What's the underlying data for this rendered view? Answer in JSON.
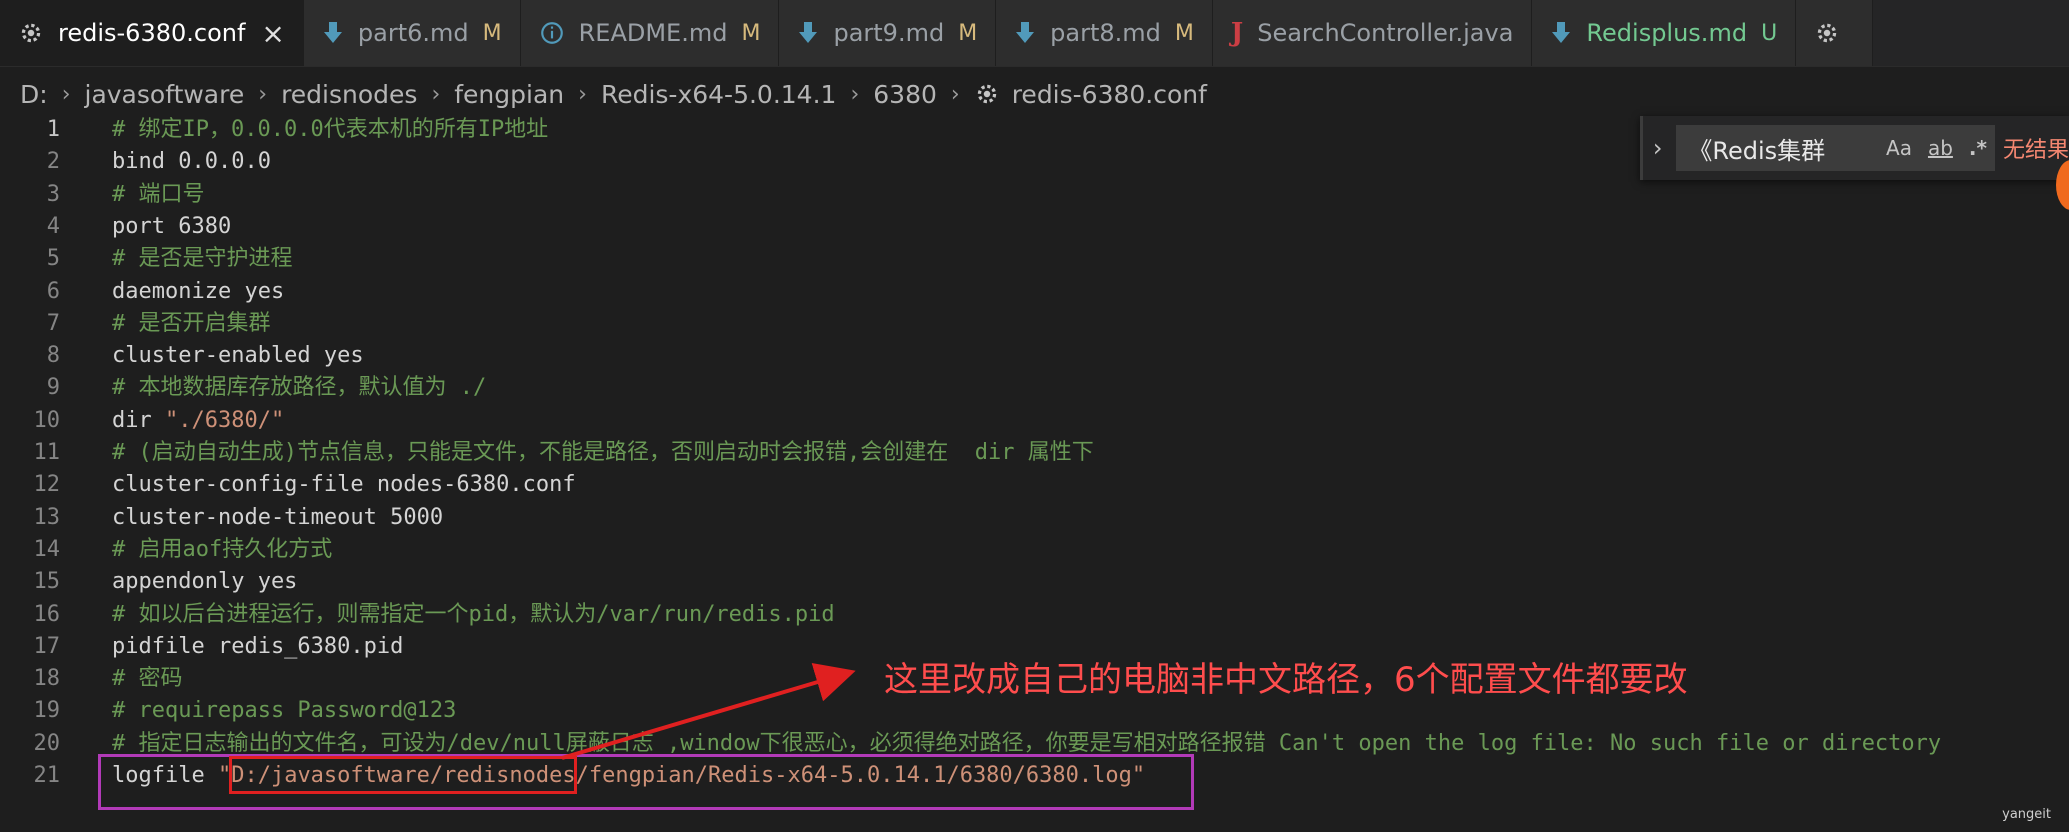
{
  "tabs": [
    {
      "label": "redis-6380.conf",
      "icon": "gear-icon",
      "badge": "",
      "active": true,
      "close": "×"
    },
    {
      "label": "part6.md",
      "icon": "markdown-download-icon",
      "badge": "M",
      "badge_color": "#d7ba7d"
    },
    {
      "label": "README.md",
      "icon": "info-icon",
      "badge": "M",
      "badge_color": "#d7ba7d"
    },
    {
      "label": "part9.md",
      "icon": "markdown-download-icon",
      "badge": "M",
      "badge_color": "#d7ba7d"
    },
    {
      "label": "part8.md",
      "icon": "markdown-download-icon",
      "badge": "M",
      "badge_color": "#d7ba7d"
    },
    {
      "label": "SearchController.java",
      "icon": "java-icon",
      "badge": ""
    },
    {
      "label": "Redisplus.md",
      "icon": "markdown-download-icon",
      "badge": "U",
      "badge_color": "#73c991",
      "label_color": "#73c991"
    }
  ],
  "breadcrumb": [
    "D:",
    "javasoftware",
    "redisnodes",
    "fengpian",
    "Redis-x64-5.0.14.1",
    "6380",
    "redis-6380.conf"
  ],
  "editor": {
    "current_line": 1,
    "lines": [
      {
        "n": "1",
        "type": "comment",
        "text": "# 绑定IP，0.0.0.0代表本机的所有IP地址"
      },
      {
        "n": "2",
        "type": "code",
        "text": "bind 0.0.0.0"
      },
      {
        "n": "3",
        "type": "comment",
        "text": "# 端口号"
      },
      {
        "n": "4",
        "type": "code",
        "text": "port 6380"
      },
      {
        "n": "5",
        "type": "comment",
        "text": "# 是否是守护进程"
      },
      {
        "n": "6",
        "type": "code",
        "text": "daemonize yes"
      },
      {
        "n": "7",
        "type": "comment",
        "text": "# 是否开启集群"
      },
      {
        "n": "8",
        "type": "code",
        "text": "cluster-enabled yes"
      },
      {
        "n": "9",
        "type": "comment",
        "text": "# 本地数据库存放路径，默认值为 ./"
      },
      {
        "n": "10",
        "type": "string",
        "text": "dir ",
        "str": "\"./6380/\""
      },
      {
        "n": "11",
        "type": "comment",
        "text": "# (启动自动生成)节点信息，只能是文件，不能是路径，否则启动时会报错,会创建在  dir 属性下"
      },
      {
        "n": "12",
        "type": "code",
        "text": "cluster-config-file nodes-6380.conf"
      },
      {
        "n": "13",
        "type": "code",
        "text": "cluster-node-timeout 5000"
      },
      {
        "n": "14",
        "type": "comment",
        "text": "# 启用aof持久化方式"
      },
      {
        "n": "15",
        "type": "code",
        "text": "appendonly yes"
      },
      {
        "n": "16",
        "type": "comment",
        "text": "# 如以后台进程运行，则需指定一个pid，默认为/var/run/redis.pid"
      },
      {
        "n": "17",
        "type": "code",
        "text": "pidfile redis_6380.pid"
      },
      {
        "n": "18",
        "type": "comment",
        "text": "# 密码"
      },
      {
        "n": "19",
        "type": "comment",
        "text": "# requirepass Password@123"
      },
      {
        "n": "20",
        "type": "comment",
        "text": "# 指定日志输出的文件名，可设为/dev/null屏蔽日志 ,window下很恶心，必须得绝对路径，你要是写相对路径报错 Can't open the log file: No such file or directory"
      },
      {
        "n": "21",
        "type": "string",
        "text": "logfile ",
        "str": "\"D:/javasoftware/redisnodes/fengpian/Redis-x64-5.0.14.1/6380/6380.log\""
      }
    ]
  },
  "find_widget": {
    "toggle_icon": "chevron-right-icon",
    "query": "《Redis集群",
    "match_case": "Aa",
    "whole_word": "ab",
    "regex": ".*",
    "result": "无结果"
  },
  "annotation": {
    "text": "这里改成自己的电脑非中文路径，6个配置文件都要改",
    "color": "#ff4d4d"
  },
  "watermark": "yangeit",
  "colors": {
    "comment": "#6a9955",
    "string": "#ce9178",
    "modified_badge": "#d7ba7d",
    "untracked_badge": "#73c991"
  }
}
